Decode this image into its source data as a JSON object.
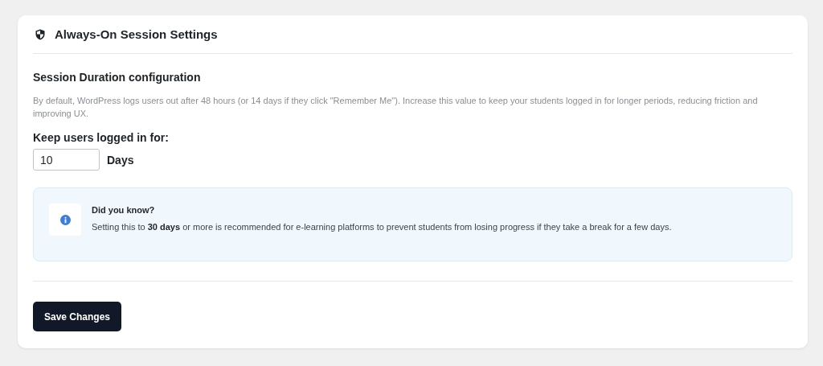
{
  "panel": {
    "title": "Always-On Session Settings"
  },
  "section": {
    "heading": "Session Duration configuration",
    "description": "By default, WordPress logs users out after 48 hours (or 14 days if they click \"Remember Me\"). Increase this value to keep your students logged in for longer periods, reducing friction and improving UX."
  },
  "duration": {
    "label": "Keep users logged in for:",
    "value": "10",
    "unit": "Days"
  },
  "notice": {
    "title": "Did you know?",
    "text": "Setting this to **30 days** or more is recommended for e-learning platforms to prevent students from losing progress if they take a break for a few days."
  },
  "buttons": [
    "Save Changes"
  ]
}
